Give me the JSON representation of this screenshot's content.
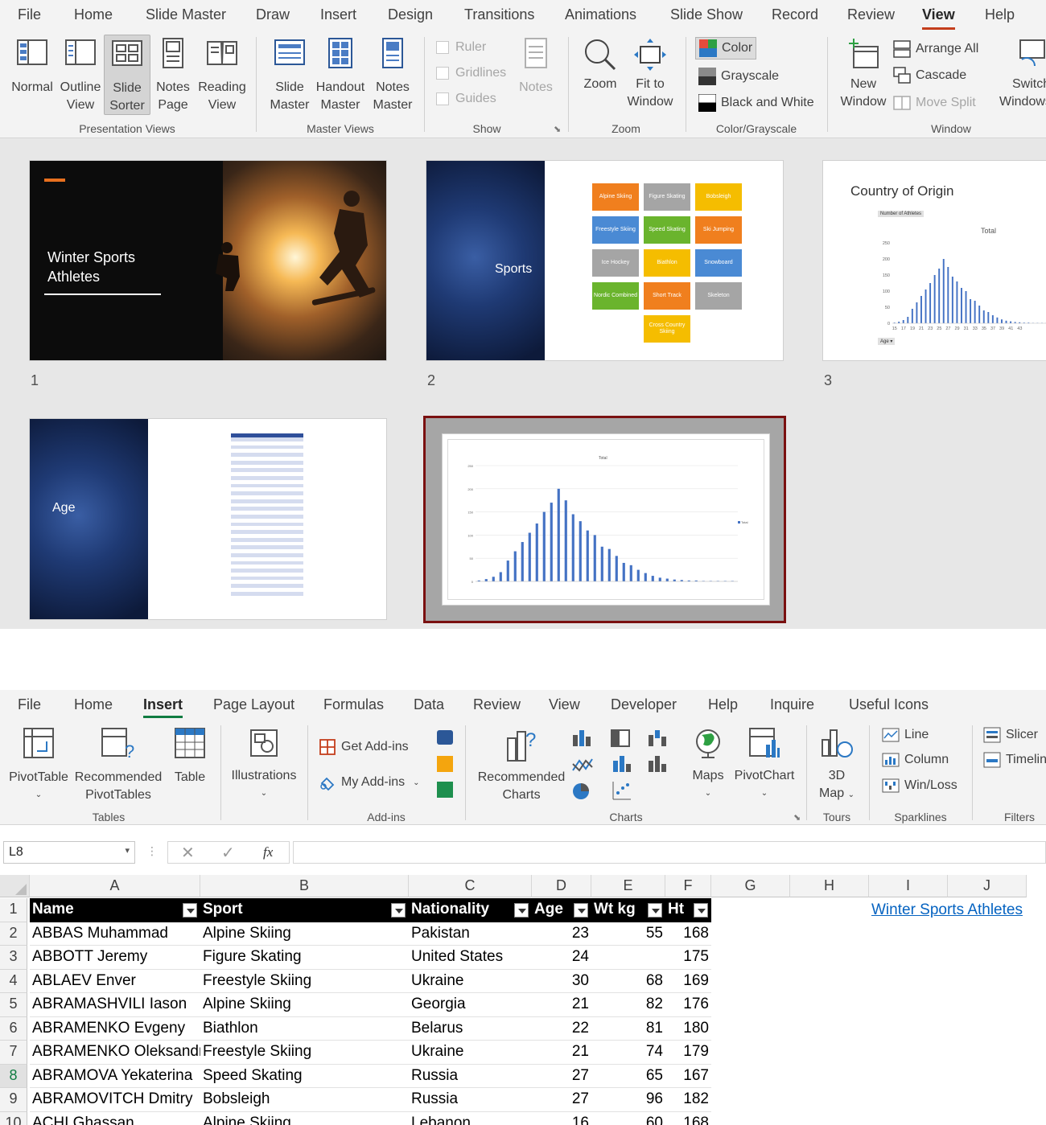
{
  "ppt": {
    "tabs": [
      "File",
      "Home",
      "Slide Master",
      "Draw",
      "Insert",
      "Design",
      "Transitions",
      "Animations",
      "Slide Show",
      "Record",
      "Review",
      "View",
      "Help"
    ],
    "active_tab": "View",
    "views": {
      "normal": [
        "Normal",
        ""
      ],
      "outline": [
        "Outline",
        "View"
      ],
      "slide_sorter": [
        "Slide",
        "Sorter"
      ],
      "notes_page": [
        "Notes",
        "Page"
      ],
      "reading": [
        "Reading",
        "View"
      ],
      "group": "Presentation Views"
    },
    "masters": {
      "slide": [
        "Slide",
        "Master"
      ],
      "handout": [
        "Handout",
        "Master"
      ],
      "notes": [
        "Notes",
        "Master"
      ],
      "group": "Master Views"
    },
    "show": {
      "ruler": "Ruler",
      "gridlines": "Gridlines",
      "guides": "Guides",
      "notes": "Notes",
      "group": "Show"
    },
    "zoom": {
      "zoom": "Zoom",
      "fit": [
        "Fit to",
        "Window"
      ],
      "group": "Zoom"
    },
    "color": {
      "color": "Color",
      "grayscale": "Grayscale",
      "bw": "Black and White",
      "group": "Color/Grayscale"
    },
    "window": {
      "new": [
        "New",
        "Window"
      ],
      "arrange": "Arrange All",
      "cascade": "Cascade",
      "move_split": "Move Split",
      "switch": [
        "Switch",
        "Windows"
      ],
      "group": "Window"
    },
    "slides": {
      "s1": {
        "num": "1",
        "title": "Winter Sports\nAthletes"
      },
      "s2": {
        "num": "2",
        "title": "Sports",
        "tiles": [
          {
            "label": "Alpine Skiing",
            "color": "#f07f1e"
          },
          {
            "label": "Figure Skating",
            "color": "#a5a5a5"
          },
          {
            "label": "Bobsleigh",
            "color": "#f5bd00"
          },
          {
            "label": "Freestyle Skiing",
            "color": "#4a8ad4"
          },
          {
            "label": "Speed Skating",
            "color": "#6ab42d"
          },
          {
            "label": "Ski Jumping",
            "color": "#f07f1e"
          },
          {
            "label": "Ice Hockey",
            "color": "#a5a5a5"
          },
          {
            "label": "Biathlon",
            "color": "#f5bd00"
          },
          {
            "label": "Snowboard",
            "color": "#4a8ad4"
          },
          {
            "label": "Nordic Combined",
            "color": "#6ab42d"
          },
          {
            "label": "Short Track",
            "color": "#f07f1e"
          },
          {
            "label": "Skeleton",
            "color": "#a5a5a5"
          },
          {
            "label": "Cross Country Skiing",
            "color": "#f5bd00"
          }
        ]
      },
      "s3": {
        "num": "3",
        "title": "Country of Origin",
        "chart_tag": "Number of Athletes",
        "chart_title": "Total",
        "filter": "Age"
      },
      "s4": {
        "num": "",
        "title": "Age"
      },
      "s5": {
        "num": "",
        "chart_title": "Total",
        "legend": "Total"
      }
    }
  },
  "chart_data": {
    "type": "bar",
    "title": "Total",
    "series": [
      {
        "name": "Total",
        "values": [
          2,
          5,
          10,
          20,
          45,
          65,
          85,
          105,
          125,
          150,
          170,
          200,
          175,
          145,
          130,
          110,
          100,
          75,
          70,
          55,
          40,
          35,
          25,
          18,
          12,
          8,
          6,
          4,
          3,
          2,
          2,
          1,
          1,
          1,
          1,
          1
        ]
      }
    ],
    "ylim": [
      0,
      250
    ],
    "ticks": [
      "0",
      "50",
      "100",
      "150",
      "200",
      "250"
    ],
    "xticks": [
      "15",
      "17",
      "19",
      "21",
      "23",
      "25",
      "27",
      "29",
      "31",
      "33",
      "35",
      "37",
      "39",
      "41",
      "43"
    ]
  },
  "excel": {
    "tabs": [
      "File",
      "Home",
      "Insert",
      "Page Layout",
      "Formulas",
      "Data",
      "Review",
      "View",
      "Developer",
      "Help",
      "Inquire",
      "Useful Icons"
    ],
    "active_tab": "Insert",
    "ribbon": {
      "pivot": [
        "PivotTable",
        ""
      ],
      "recpivot": [
        "Recommended",
        "PivotTables"
      ],
      "table": "Table",
      "tables_group": "Tables",
      "illustrations": "Illustrations",
      "get_addins": "Get Add-ins",
      "my_addins": "My Add-ins",
      "addins_group": "Add-ins",
      "rec_charts": [
        "Recommended",
        "Charts"
      ],
      "maps": "Maps",
      "pivotchart": "PivotChart",
      "charts_group": "Charts",
      "map3d": [
        "3D",
        "Map"
      ],
      "tours_group": "Tours",
      "line": "Line",
      "column": "Column",
      "winloss": "Win/Loss",
      "spark_group": "Sparklines",
      "slicer": "Slicer",
      "timeline": "Timeline",
      "filters_group": "Filters"
    },
    "namebox": "L8",
    "fx": "fx",
    "columns": [
      "A",
      "B",
      "C",
      "D",
      "E",
      "F",
      "G",
      "H",
      "I",
      "J"
    ],
    "headers": [
      "Name",
      "Sport",
      "Nationality",
      "Age",
      "Wt kg",
      "Ht"
    ],
    "rows": [
      [
        "ABBAS Muhammad",
        "Alpine Skiing",
        "Pakistan",
        "23",
        "55",
        "168"
      ],
      [
        "ABBOTT Jeremy",
        "Figure Skating",
        "United States",
        "24",
        "",
        "175"
      ],
      [
        "ABLAEV Enver",
        "Freestyle Skiing",
        "Ukraine",
        "30",
        "68",
        "169"
      ],
      [
        "ABRAMASHVILI Iason",
        "Alpine Skiing",
        "Georgia",
        "21",
        "82",
        "176"
      ],
      [
        "ABRAMENKO Evgeny",
        "Biathlon",
        "Belarus",
        "22",
        "81",
        "180"
      ],
      [
        "ABRAMENKO Oleksandr",
        "Freestyle Skiing",
        "Ukraine",
        "21",
        "74",
        "179"
      ],
      [
        "ABRAMOVA Yekaterina",
        "Speed Skating",
        "Russia",
        "27",
        "65",
        "167"
      ],
      [
        "ABRAMOVITCH Dmitry",
        "Bobsleigh",
        "Russia",
        "27",
        "96",
        "182"
      ],
      [
        "ACHI Ghassan",
        "Alpine Skiing",
        "Lebanon",
        "16",
        "60",
        "168"
      ]
    ],
    "row_numbers": [
      "1",
      "2",
      "3",
      "4",
      "5",
      "6",
      "7",
      "8",
      "9",
      "10"
    ],
    "link": "Winter Sports Athletes"
  }
}
